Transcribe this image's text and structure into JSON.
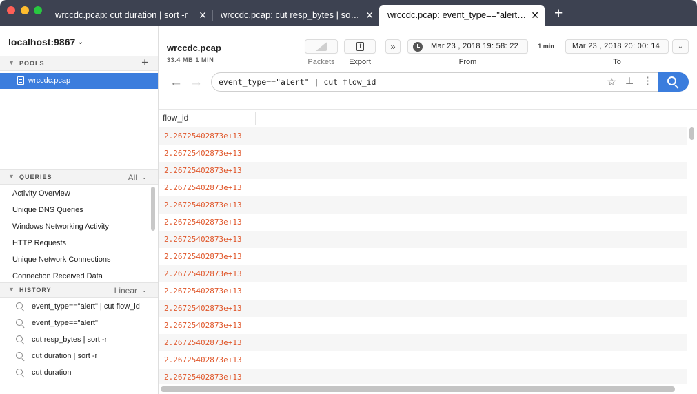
{
  "tabs": [
    {
      "label": "wrccdc.pcap: cut duration | sort -r",
      "close": "✕",
      "active": false
    },
    {
      "label": "wrccdc.pcap: cut resp_bytes | sort -r",
      "close": "✕",
      "active": false
    },
    {
      "label": "wrccdc.pcap: event_type==\"alert\" | cut flow_id",
      "close": "✕",
      "active": true
    }
  ],
  "new_tab": "+",
  "sidebar": {
    "host": "localhost:9867",
    "pools": {
      "title": "POOLS",
      "items": [
        {
          "label": "wrccdc.pcap"
        }
      ]
    },
    "queries": {
      "title": "QUERIES",
      "filter": "All",
      "items": [
        "Activity Overview",
        "Unique DNS Queries",
        "Windows Networking Activity",
        "HTTP Requests",
        "Unique Network Connections",
        "Connection Received Data"
      ]
    },
    "history": {
      "title": "HISTORY",
      "mode": "Linear",
      "items": [
        "event_type==\"alert\" | cut flow_id",
        "event_type==\"alert\"",
        "cut resp_bytes | sort -r",
        "cut duration | sort -r",
        "cut duration"
      ]
    }
  },
  "toolbar": {
    "pcap_name": "wrccdc.pcap",
    "pcap_meta": "33.4 MB   1 MIN",
    "packets_label": "Packets",
    "export_label": "Export",
    "from_label": "From",
    "to_label": "To",
    "from_date": "Mar 23 , 2018  19: 58: 22",
    "to_date": "Mar 23 , 2018  20: 00: 14",
    "duration": "1 min",
    "ffwd_glyph": "»",
    "range_glyph": "⌄"
  },
  "search": {
    "value": "event_type==\"alert\" | cut flow_id",
    "back_glyph": "←",
    "fwd_glyph": "→",
    "star_glyph": "☆",
    "pin_glyph": "📌",
    "more_glyph": "⋮"
  },
  "results": {
    "column": "flow_id",
    "rows": [
      "2.26725402873e+13",
      "2.26725402873e+13",
      "2.26725402873e+13",
      "2.26725402873e+13",
      "2.26725402873e+13",
      "2.26725402873e+13",
      "2.26725402873e+13",
      "2.26725402873e+13",
      "2.26725402873e+13",
      "2.26725402873e+13",
      "2.26725402873e+13",
      "2.26725402873e+13",
      "2.26725402873e+13",
      "2.26725402873e+13",
      "2.26725402873e+13"
    ]
  },
  "colors": {
    "accent": "#3b7ddd",
    "value_text": "#e0582c",
    "titlebar": "#3d4251"
  }
}
